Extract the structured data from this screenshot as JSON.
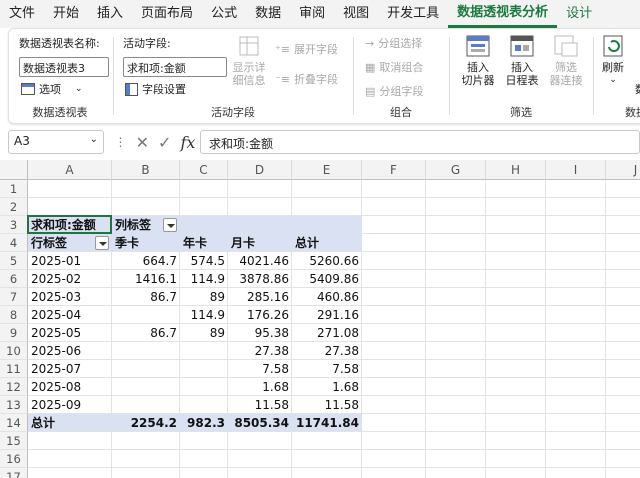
{
  "menu": [
    "文件",
    "开始",
    "插入",
    "页面布局",
    "公式",
    "数据",
    "审阅",
    "视图",
    "开发工具",
    "数据透视表分析",
    "设计"
  ],
  "ribbon": {
    "pivot_name_label": "数据透视表名称:",
    "pivot_name_value": "数据透视表3",
    "options_label": "选项",
    "group_pivot": "数据透视表",
    "active_field_label": "活动字段:",
    "active_field_value": "求和项:金额",
    "field_settings_label": "字段设置",
    "drilldown_label": "显示详\n细信息",
    "expand_label": "展开字段",
    "collapse_label": "折叠字段",
    "group_active_field": "活动字段",
    "group_selection_label": "分组选择",
    "ungroup_label": "取消组合",
    "group_field_label": "分组字段",
    "group_group": "组合",
    "insert_slicer_label": "插入\n切片器",
    "insert_timeline_label": "插入\n日程表",
    "filter_connections_label": "筛选\n器连接",
    "group_filter": "筛选",
    "refresh_label": "刷新",
    "data_partial": "数",
    "group_data_partial": "数据"
  },
  "formula_bar": {
    "name_box": "A3",
    "formula": "求和项:金额"
  },
  "columns": [
    "A",
    "B",
    "C",
    "D",
    "E",
    "F",
    "G",
    "H",
    "I",
    "J"
  ],
  "rows": [
    "1",
    "2",
    "3",
    "4",
    "5",
    "6",
    "7",
    "8",
    "9",
    "10",
    "11",
    "12",
    "13",
    "14",
    "15",
    "16",
    "17"
  ],
  "pivot": {
    "corner_label": "求和项:金额",
    "col_label": "列标签",
    "row_label": "行标签",
    "headers": [
      "季卡",
      "年卡",
      "月卡",
      "总计"
    ],
    "data": [
      [
        "2025-01",
        "664.7",
        "574.5",
        "4021.46",
        "5260.66"
      ],
      [
        "2025-02",
        "1416.1",
        "114.9",
        "3878.86",
        "5409.86"
      ],
      [
        "2025-03",
        "86.7",
        "89",
        "285.16",
        "460.86"
      ],
      [
        "2025-04",
        "",
        "114.9",
        "176.26",
        "291.16"
      ],
      [
        "2025-05",
        "86.7",
        "89",
        "95.38",
        "271.08"
      ],
      [
        "2025-06",
        "",
        "",
        "27.38",
        "27.38"
      ],
      [
        "2025-07",
        "",
        "",
        "7.58",
        "7.58"
      ],
      [
        "2025-08",
        "",
        "",
        "1.68",
        "1.68"
      ],
      [
        "2025-09",
        "",
        "",
        "11.58",
        "11.58"
      ]
    ],
    "total_label": "总计",
    "totals": [
      "2254.2",
      "982.3",
      "8505.34",
      "11741.84"
    ]
  },
  "colors": {
    "pivot_header": "#d9e1f2",
    "accent": "#1d7a3f"
  }
}
